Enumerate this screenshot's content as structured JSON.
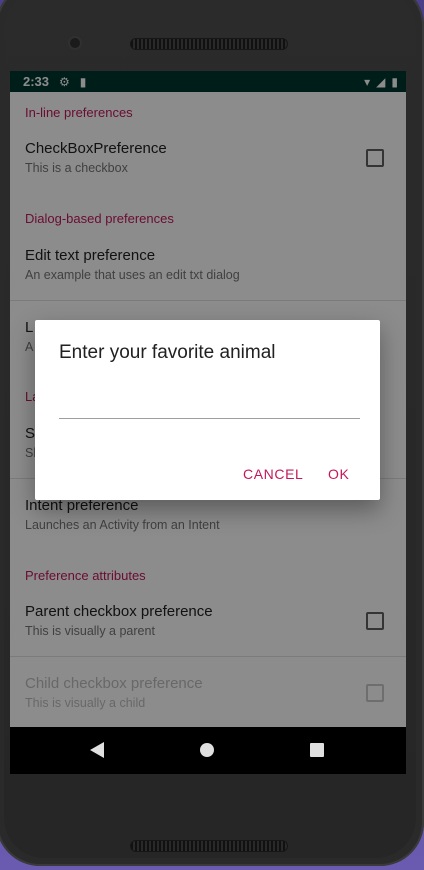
{
  "statusbar": {
    "time": "2:33",
    "icons_left": [
      "settings-gear-icon",
      "sd-card-icon"
    ],
    "icons_right": [
      "wifi-icon",
      "cellular-signal-icon",
      "battery-icon"
    ]
  },
  "preferences": {
    "inline_category": "In-line preferences",
    "checkbox_title": "CheckBoxPreference",
    "checkbox_summary": "This is a checkbox",
    "checkbox_checked": false,
    "dialog_category": "Dialog-based preferences",
    "edit_text_title": "Edit text preference",
    "edit_text_summary": "An example that uses an edit txt dialog",
    "list_title_partial": "L",
    "list_summary_partial": "A",
    "launch_category_partial": "La",
    "screen_title_partial": "S",
    "screen_summary_partial": "Sh",
    "intent_title": "Intent preference",
    "intent_summary": "Launches an Activity from an Intent",
    "attributes_category": "Preference attributes",
    "parent_title": "Parent checkbox preference",
    "parent_summary": "This is visually a parent",
    "parent_checked": false,
    "child_title": "Child checkbox preference",
    "child_summary": "This is visually a child",
    "child_checked": false
  },
  "dialog": {
    "title": "Enter your favorite animal",
    "input_value": "",
    "cancel_label": "CANCEL",
    "ok_label": "OK"
  },
  "navbar": {
    "buttons": [
      "back-icon",
      "home-icon",
      "recents-icon"
    ]
  },
  "colors": {
    "status_bar": "#00382f",
    "accent": "#c2185b",
    "device_bg": "#5b4e9e"
  }
}
